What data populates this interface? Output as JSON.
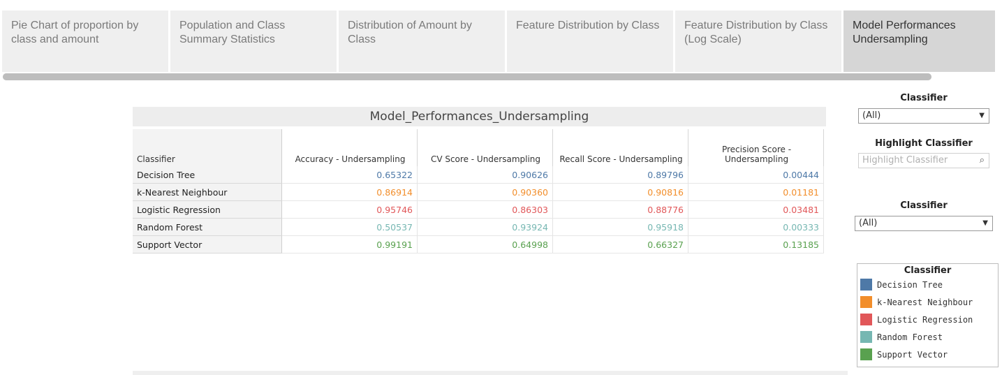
{
  "tabs": [
    {
      "label": "Pie Chart of proportion by class and amount",
      "active": false
    },
    {
      "label": "Population and Class Summary Statistics",
      "active": false
    },
    {
      "label": "Distribution of Amount by Class",
      "active": false
    },
    {
      "label": "Feature Distribution by Class",
      "active": false
    },
    {
      "label": "Feature Distribution by Class (Log Scale)",
      "active": false
    },
    {
      "label": "Model Performances Undersampling",
      "active": true
    }
  ],
  "table": {
    "title": "Model_Performances_Undersampling",
    "row_header": "Classifier",
    "columns": [
      "Accuracy - Undersampling",
      "CV Score - Undersampling",
      "Recall Score - Undersampling",
      "Precision Score - Undersampling"
    ],
    "rows": [
      {
        "label": "Decision Tree",
        "color": "#4e79a7",
        "values": [
          "0.65322",
          "0.90626",
          "0.89796",
          "0.00444"
        ]
      },
      {
        "label": "k-Nearest Neighbour",
        "color": "#f28e2b",
        "values": [
          "0.86914",
          "0.90360",
          "0.90816",
          "0.01181"
        ]
      },
      {
        "label": "Logistic Regression",
        "color": "#e15759",
        "values": [
          "0.95746",
          "0.86303",
          "0.88776",
          "0.03481"
        ]
      },
      {
        "label": "Random Forest",
        "color": "#76b7b2",
        "values": [
          "0.50537",
          "0.93924",
          "0.95918",
          "0.00333"
        ]
      },
      {
        "label": "Support Vector",
        "color": "#59a14f",
        "values": [
          "0.99191",
          "0.64998",
          "0.66327",
          "0.13185"
        ]
      }
    ]
  },
  "filters": {
    "classifier1": {
      "label": "Classifier",
      "value": "(All)"
    },
    "highlight": {
      "label": "Highlight Classifier",
      "placeholder": "Highlight Classifier"
    },
    "classifier2": {
      "label": "Classifier",
      "value": "(All)"
    }
  },
  "legend": {
    "title": "Classifier",
    "items": [
      {
        "label": "Decision Tree",
        "color": "#4e79a7"
      },
      {
        "label": "k-Nearest Neighbour",
        "color": "#f28e2b"
      },
      {
        "label": "Logistic Regression",
        "color": "#e15759"
      },
      {
        "label": "Random Forest",
        "color": "#76b7b2"
      },
      {
        "label": "Support Vector",
        "color": "#59a14f"
      }
    ]
  },
  "icons": {
    "dropdown": "caret-down-icon",
    "search": "search-icon"
  }
}
